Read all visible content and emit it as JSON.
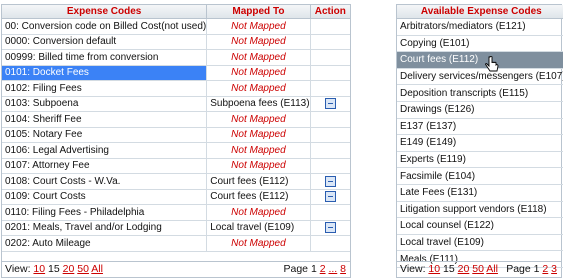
{
  "left": {
    "headers": {
      "code": "Expense Codes",
      "mapped": "Mapped To",
      "action": "Action"
    },
    "rows": [
      {
        "code": "00: Conversion code on Billed Cost(not used)",
        "mapped": "Not Mapped"
      },
      {
        "code": "0000: Conversion default",
        "mapped": "Not Mapped"
      },
      {
        "code": "00999: Billed time from conversion",
        "mapped": "Not Mapped"
      },
      {
        "code": "0101: Docket Fees",
        "mapped": "Not Mapped"
      },
      {
        "code": "0102: Filing Fees",
        "mapped": "Not Mapped"
      },
      {
        "code": "0103: Subpoena",
        "mapped": "Subpoena fees (E113)"
      },
      {
        "code": "0104: Sheriff Fee",
        "mapped": "Not Mapped"
      },
      {
        "code": "0105: Notary Fee",
        "mapped": "Not Mapped"
      },
      {
        "code": "0106: Legal Advertising",
        "mapped": "Not Mapped"
      },
      {
        "code": "0107: Attorney Fee",
        "mapped": "Not Mapped"
      },
      {
        "code": "0108: Court Costs - W.Va.",
        "mapped": "Court fees (E112)"
      },
      {
        "code": "0109: Court Costs",
        "mapped": "Court fees (E112)"
      },
      {
        "code": "0110: Filing Fees - Philadelphia",
        "mapped": "Not Mapped"
      },
      {
        "code": "0201: Meals, Travel and/or Lodging",
        "mapped": "Local travel (E109)"
      },
      {
        "code": "0202: Auto Mileage",
        "mapped": "Not Mapped"
      }
    ],
    "pager": {
      "view_label": "View:",
      "sizes": [
        "10",
        "15",
        "20",
        "50",
        "All"
      ],
      "current_size": "15",
      "page_label": "Page 1",
      "page2": "2",
      "ellipsis": "...",
      "last": "8"
    }
  },
  "right": {
    "header": "Available Expense Codes",
    "items": [
      "Arbitrators/mediators (E121)",
      "Copying (E101)",
      "Court fees (E112)",
      "Delivery services/messengers (E107)",
      "Deposition transcripts (E115)",
      "Drawings (E126)",
      "E137 (E137)",
      "E149 (E149)",
      "Experts (E119)",
      "Facsimile (E104)",
      "Late Fees (E131)",
      "Litigation support vendors (E118)",
      "Local counsel (E122)",
      "Local travel (E109)",
      "Meals (E111)"
    ],
    "pager": {
      "view_label": "View:",
      "sizes": [
        "10",
        "15",
        "20",
        "50",
        "All"
      ],
      "current_size": "15",
      "page_label": "Page 1",
      "page2": "2",
      "page3": "3"
    }
  },
  "colors": {
    "header_text": "#cc0000",
    "selected_row": "#3b82f6",
    "hover_item": "#7f8f9e",
    "not_mapped": "#cc0000"
  }
}
